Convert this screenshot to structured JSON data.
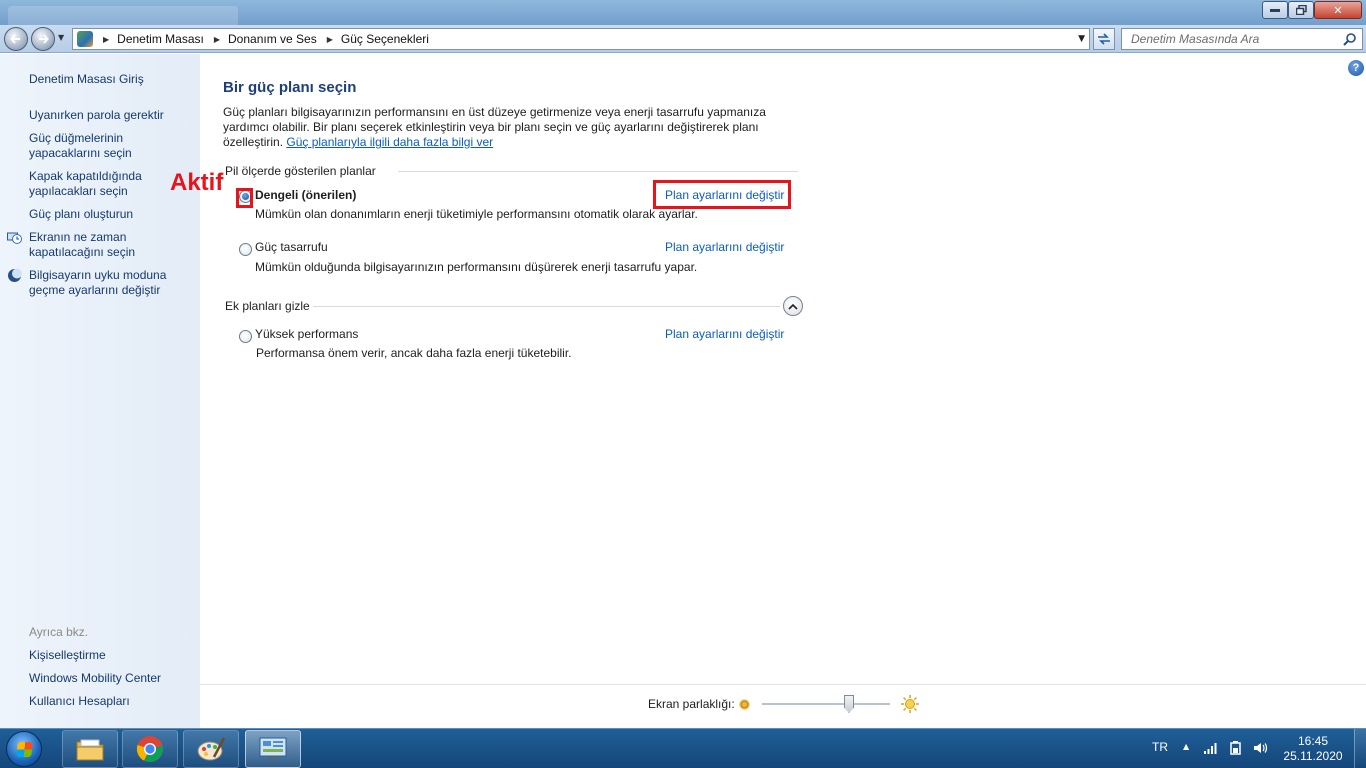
{
  "window": {
    "buttons": {
      "minimize": "",
      "maximize": "",
      "close": "✕"
    }
  },
  "navigation": {
    "breadcrumbs": [
      "Denetim Masası",
      "Donanım ve Ses",
      "Güç Seçenekleri"
    ],
    "search_placeholder": "Denetim Masasında Ara"
  },
  "sidebar": {
    "home_link": "Denetim Masası Giriş",
    "tasks": [
      {
        "label": "Uyanırken parola gerektir",
        "icon": "none"
      },
      {
        "label": "Güç düğmelerinin yapacaklarını seçin",
        "icon": "none"
      },
      {
        "label": "Kapak kapatıldığında yapılacakları seçin",
        "icon": "none"
      },
      {
        "label": "Güç planı oluşturun",
        "icon": "none"
      },
      {
        "label": "Ekranın ne zaman kapatılacağını seçin",
        "icon": "display-timer-icon"
      },
      {
        "label": "Bilgisayarın uyku moduna geçme ayarlarını değiştir",
        "icon": "sleep-moon-icon"
      }
    ],
    "see_also_title": "Ayrıca bkz.",
    "see_also": [
      "Kişiselleştirme",
      "Windows Mobility Center",
      "Kullanıcı Hesapları"
    ]
  },
  "main": {
    "title": "Bir güç planı seçin",
    "intro_text": "Güç planları bilgisayarınızın performansını en üst düzeye getirmenize veya enerji tasarrufu yapmanıza yardımcı olabilir. Bir planı seçerek etkinleştirin veya bir planı seçin ve güç ayarlarını değiştirerek planı özelleştirin. ",
    "intro_link": "Güç planlarıyla ilgili daha fazla bilgi ver",
    "group_shown": "Pil ölçerde gösterilen planlar",
    "group_extra": "Ek planları gizle",
    "plans": [
      {
        "name": "Dengeli (önerilen)",
        "description": "Mümkün olan donanımların enerji tüketimiyle performansını otomatik olarak ayarlar.",
        "link": "Plan ayarlarını değiştir",
        "selected": true
      },
      {
        "name": "Güç tasarrufu",
        "description": "Mümkün olduğunda bilgisayarınızın performansını düşürerek enerji tasarrufu yapar.",
        "link": "Plan ayarlarını değiştir",
        "selected": false
      },
      {
        "name": "Yüksek performans",
        "description": "Performansa önem verir, ancak daha fazla enerji tüketebilir.",
        "link": "Plan ayarlarını değiştir",
        "selected": false
      }
    ],
    "annotation_label": "Aktif",
    "annotation_color": "#e8141c",
    "brightness_label": "Ekran parlaklığı:",
    "brightness_level": 0.68
  },
  "taskbar": {
    "apps": [
      "windows-explorer-icon",
      "chrome-icon",
      "paint-icon",
      "control-panel-icon"
    ],
    "active_app": "control-panel-icon",
    "language": "TR",
    "time": "16:45",
    "date": "25.11.2020"
  },
  "colors": {
    "link": "#0b5cc1",
    "title": "#1e3f7a",
    "sidebar_link": "#143a6e",
    "taskbar": "#1a5288"
  }
}
